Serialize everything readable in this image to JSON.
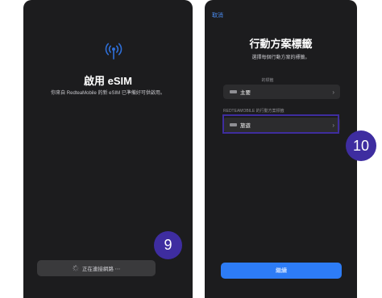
{
  "left_screen": {
    "title": "啟用 eSIM",
    "description": "你來自 RedteaMobile 的新 eSIM 已準備好可供啟用。",
    "status_button_label": "正在連接網路 ⋯",
    "icons": {
      "header": "antenna-signal-icon",
      "status": "spinner-icon"
    },
    "step_number": "9"
  },
  "right_screen": {
    "cancel_label": "取消",
    "title": "行動方案標籤",
    "subtitle": "選擇每個行動方案的標籤。",
    "section_primary_label": "的標籤",
    "primary_plan_label": "主要",
    "section_redtea_label": "REDTEAMOBILE 的行動方案標籤",
    "redtea_plan_label": "旅遊",
    "continue_label": "繼續",
    "icons": {
      "sim": "sim-tag-icon",
      "row_disclosure": "chevron-right-icon"
    },
    "step_number": "10"
  },
  "colors": {
    "screen_bg": "#1c1c1e",
    "row_bg": "#2c2c2e",
    "accent_blue": "#2d7cf6",
    "badge_purple": "#3e2da0"
  }
}
